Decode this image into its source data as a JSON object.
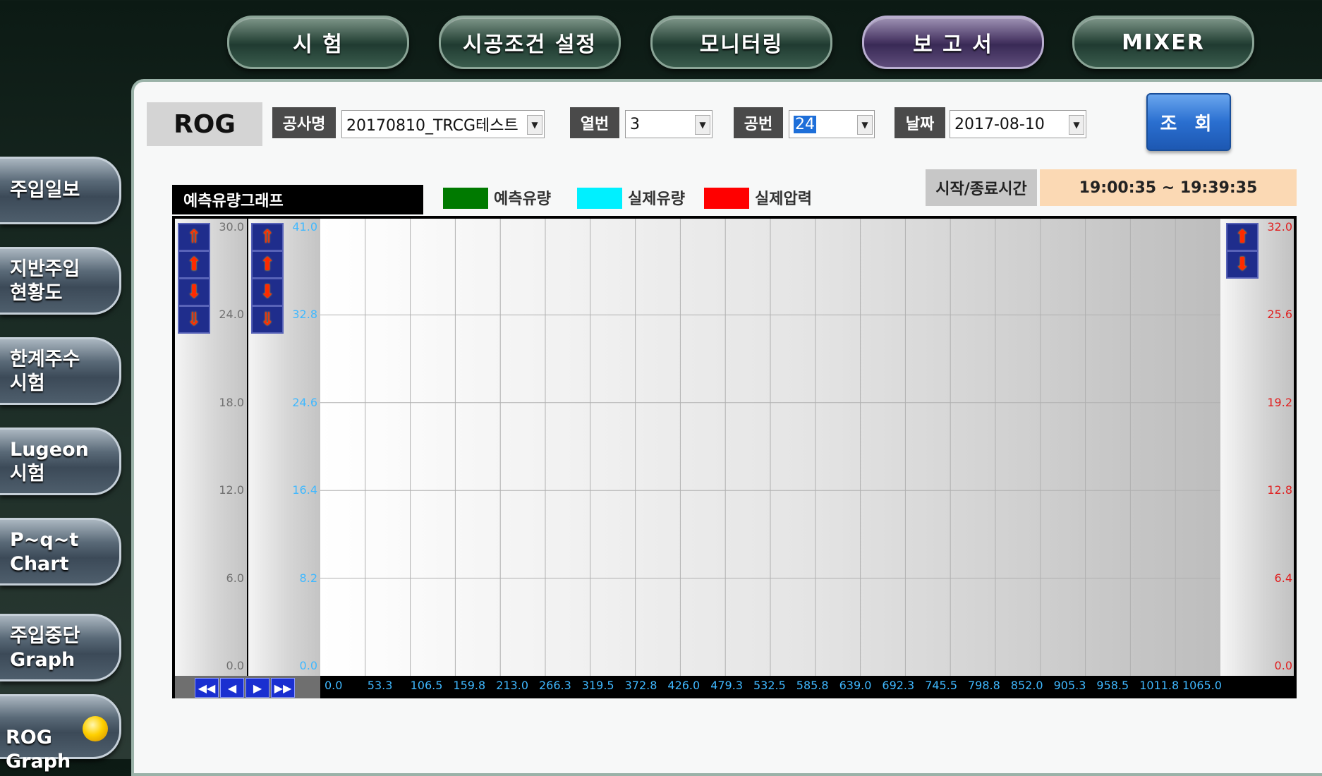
{
  "top_nav": [
    {
      "label": "시   험",
      "active": false
    },
    {
      "label": "시공조건 설정",
      "active": false
    },
    {
      "label": "모니터링",
      "active": false
    },
    {
      "label": "보 고 서",
      "active": true
    },
    {
      "label": "MIXER",
      "active": false
    }
  ],
  "side_nav": [
    {
      "label": "주입일보"
    },
    {
      "label": "지반주입\n현황도"
    },
    {
      "label": "한계주수\n시험"
    },
    {
      "label": "Lugeon\n시험"
    },
    {
      "label": "P~q~t\nChart"
    },
    {
      "label": "주입중단\nGraph"
    },
    {
      "label": "ROG\nGraph",
      "indicator": "yellow-dot"
    }
  ],
  "header": {
    "title": "ROG",
    "project_label": "공사명",
    "project_value": "20170810_TRCG테스트",
    "row_label": "열번",
    "row_value": "3",
    "hole_label": "공번",
    "hole_value": "24",
    "date_label": "날짜",
    "date_value": "2017-08-10",
    "query_button": "조 회"
  },
  "chart_header": {
    "graph_title": "예측유량그래프",
    "time_label": "시작/종료시간",
    "time_value": "19:00:35 ~ 19:39:35"
  },
  "legend": [
    {
      "name": "예측유량",
      "color": "#007a00"
    },
    {
      "name": "실제유량",
      "color": "#00f0ff"
    },
    {
      "name": "실제압력",
      "color": "#ff0000"
    }
  ],
  "chart_data": {
    "type": "line",
    "title": "예측유량그래프",
    "series": [],
    "y_left1": {
      "ticks": [
        "30.0",
        "24.0",
        "18.0",
        "12.0",
        "6.0",
        "0.0"
      ],
      "color": "#707070"
    },
    "y_left2": {
      "ticks": [
        "41.0",
        "32.8",
        "24.6",
        "16.4",
        "8.2",
        "0.0"
      ],
      "color": "#3fb8ff"
    },
    "y_right": {
      "ticks": [
        "32.0",
        "25.6",
        "19.2",
        "12.8",
        "6.4",
        "0.0"
      ],
      "color": "#e02020"
    },
    "x_ticks": [
      "0.0",
      "53.3",
      "106.5",
      "159.8",
      "213.0",
      "266.3",
      "319.5",
      "372.8",
      "426.0",
      "479.3",
      "532.5",
      "585.8",
      "639.0",
      "692.3",
      "745.5",
      "798.8",
      "852.0",
      "905.3",
      "958.5",
      "1011.8",
      "1065.0"
    ],
    "grid": true
  },
  "scale_buttons": [
    "arrow-up-fast",
    "arrow-up",
    "arrow-down",
    "arrow-down-fast"
  ],
  "nav_buttons": [
    "rewind-icon",
    "prev-icon",
    "next-icon",
    "fast-forward-icon"
  ]
}
